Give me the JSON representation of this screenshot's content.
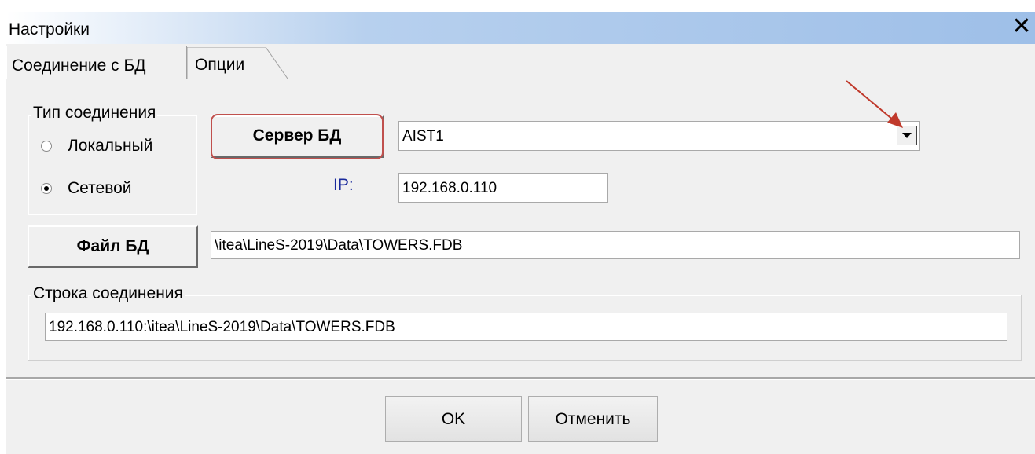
{
  "window": {
    "title": "Настройки",
    "close_glyph": "✕"
  },
  "tabs": [
    {
      "label": "Соединение с БД",
      "active": true
    },
    {
      "label": "Опции",
      "active": false
    }
  ],
  "connection_type": {
    "legend": "Тип соединения",
    "options": [
      {
        "label": "Локальный",
        "selected": false
      },
      {
        "label": "Сетевой",
        "selected": true
      }
    ]
  },
  "server": {
    "button_label": "Сервер БД",
    "selected_value": "AIST1",
    "ip_label": "IP:",
    "ip_value": "192.168.0.110"
  },
  "db_file": {
    "button_label": "Файл БД",
    "path_value": "\\itea\\LineS-2019\\Data\\TOWERS.FDB"
  },
  "connection_string": {
    "legend": "Строка соединения",
    "value": "192.168.0.110:\\itea\\LineS-2019\\Data\\TOWERS.FDB"
  },
  "footer": {
    "ok_label": "OK",
    "cancel_label": "Отменить"
  },
  "annotation": {
    "highlight_color": "#c0504d",
    "arrow_color": "#c0392b"
  }
}
